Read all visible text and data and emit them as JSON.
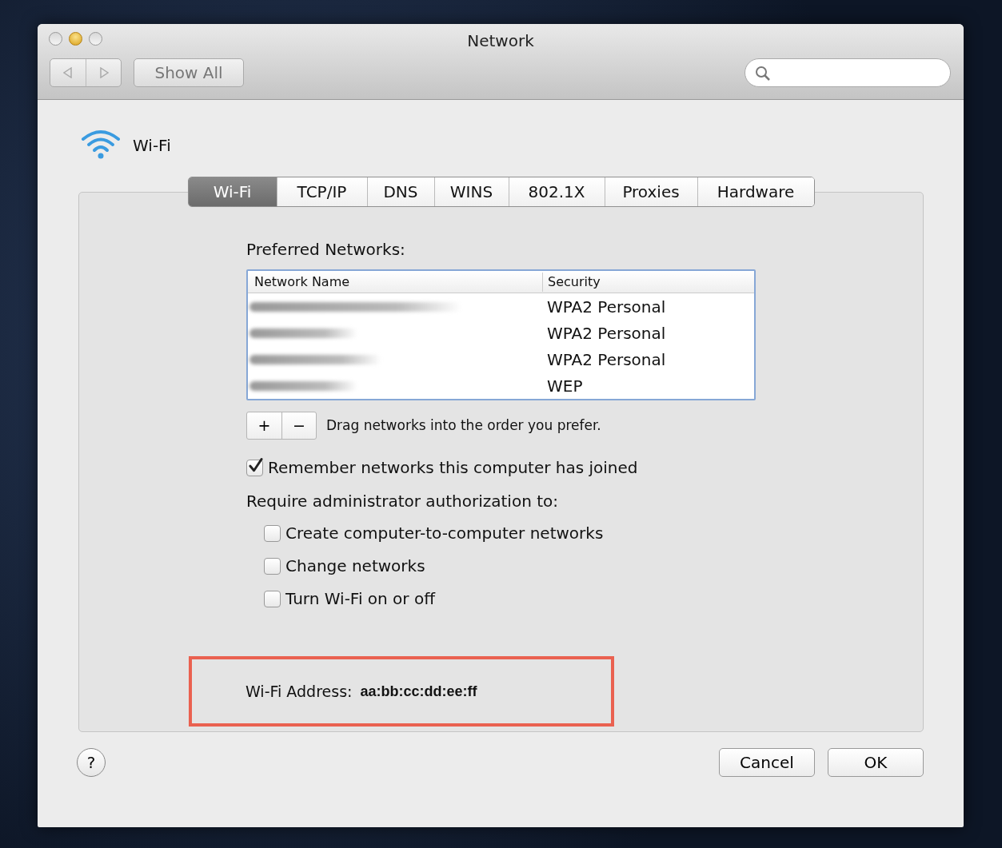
{
  "window": {
    "title": "Network"
  },
  "toolbar": {
    "show_all": "Show All"
  },
  "service": {
    "name": "Wi-Fi"
  },
  "tabs": [
    {
      "label": "Wi-Fi",
      "selected": true
    },
    {
      "label": "TCP/IP",
      "selected": false
    },
    {
      "label": "DNS",
      "selected": false
    },
    {
      "label": "WINS",
      "selected": false
    },
    {
      "label": "802.1X",
      "selected": false
    },
    {
      "label": "Proxies",
      "selected": false
    },
    {
      "label": "Hardware",
      "selected": false
    }
  ],
  "preferred_networks": {
    "label": "Preferred Networks:",
    "columns": [
      "Network Name",
      "Security"
    ],
    "rows": [
      {
        "security": "WPA2 Personal"
      },
      {
        "security": "WPA2 Personal"
      },
      {
        "security": "WPA2 Personal"
      },
      {
        "security": "WEP"
      }
    ],
    "add": "+",
    "remove": "−",
    "hint": "Drag networks into the order you prefer."
  },
  "remember": {
    "label": "Remember networks this computer has joined",
    "checked": true
  },
  "require_admin": {
    "label": "Require administrator authorization to:",
    "items": [
      {
        "label": "Create computer-to-computer networks",
        "checked": false
      },
      {
        "label": "Change networks",
        "checked": false
      },
      {
        "label": "Turn Wi-Fi on or off",
        "checked": false
      }
    ]
  },
  "wifi_address": {
    "label": "Wi-Fi Address:",
    "value": "aa:bb:cc:dd:ee:ff"
  },
  "help": "?",
  "buttons": [
    "Cancel",
    "OK"
  ]
}
